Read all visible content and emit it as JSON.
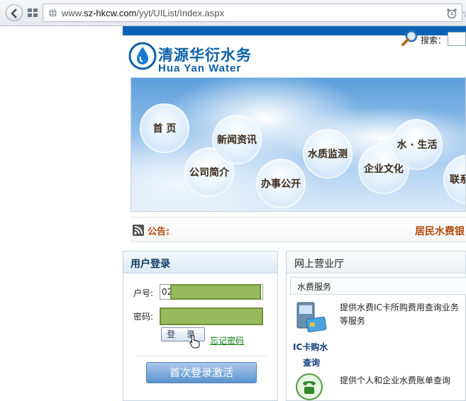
{
  "browser": {
    "url_prefix": "www.",
    "url_domain": "sz-hkcw.com",
    "url_path": "/yyt/UIList/Index.aspx"
  },
  "header": {
    "search_label": "搜索：",
    "logo_cn": "清源华衍水务",
    "logo_en": "Hua Yan Water"
  },
  "nav": {
    "home": "首 页",
    "company": "公司简介",
    "news": "新闻资讯",
    "affairs": "办事公开",
    "quality": "水质监测",
    "culture": "企业文化",
    "life": "水 · 生活",
    "contact": "联系"
  },
  "notice": {
    "label": "公告:",
    "marquee": "居民水费银"
  },
  "login": {
    "title": "用户登录",
    "account_label": "户号:",
    "account_value": "02",
    "password_label": "密码:",
    "login_button": "登 录",
    "forgot_link": "忘记密码",
    "activate_button": "首次登录激活"
  },
  "hall": {
    "title": "网上营业厅",
    "tab": "水费服务",
    "services": [
      {
        "name_line1": "IC卡购水",
        "name_line2": "查询",
        "desc_line1": "提供水费IC卡所购费用查询业务",
        "desc_line2": "等服务"
      },
      {
        "desc_line1": "提供个人和企业水费账单查询"
      }
    ]
  }
}
